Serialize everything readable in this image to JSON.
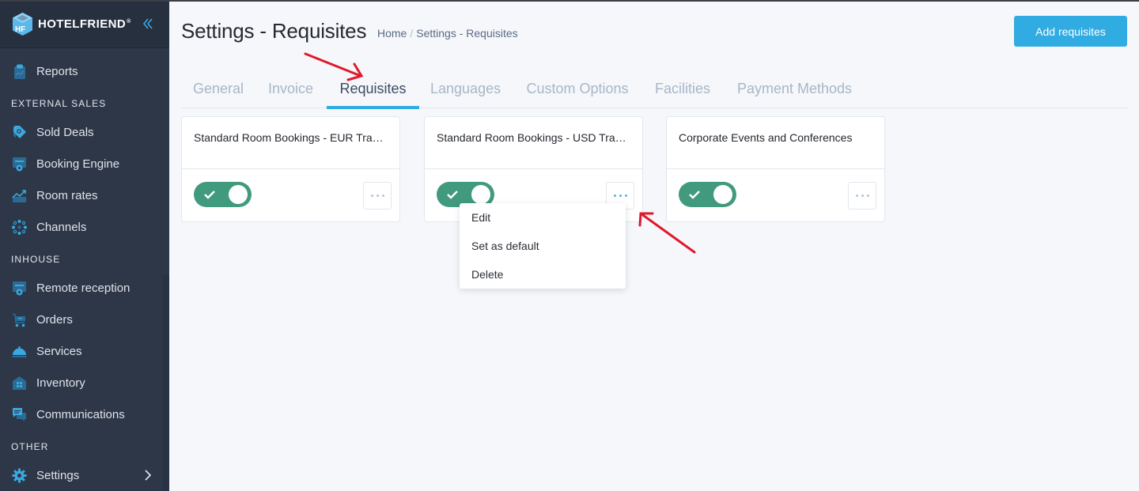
{
  "app": {
    "brand": "HOTELFRIEND",
    "brand_mark": "®",
    "logo_initials": "HF"
  },
  "sidebar": {
    "items_top": [
      {
        "label": "Reports",
        "icon": "clipboard-chart-icon"
      }
    ],
    "sections": [
      {
        "title": "EXTERNAL SALES",
        "items": [
          {
            "label": "Sold Deals",
            "icon": "tag-icon"
          },
          {
            "label": "Booking Engine",
            "icon": "browser-gear-icon"
          },
          {
            "label": "Room rates",
            "icon": "chart-rising-icon"
          },
          {
            "label": "Channels",
            "icon": "network-icon"
          }
        ]
      },
      {
        "title": "INHOUSE",
        "items": [
          {
            "label": "Remote reception",
            "icon": "browser-gear-icon"
          },
          {
            "label": "Orders",
            "icon": "cart-icon"
          },
          {
            "label": "Services",
            "icon": "cloche-icon"
          },
          {
            "label": "Inventory",
            "icon": "house-grid-icon"
          },
          {
            "label": "Communications",
            "icon": "chat-icon"
          }
        ]
      },
      {
        "title": "OTHER",
        "items": [
          {
            "label": "Settings",
            "icon": "gear-icon",
            "has_submenu": true
          }
        ]
      }
    ]
  },
  "header": {
    "title": "Settings - Requisites",
    "breadcrumb": [
      "Home",
      "Settings - Requisites"
    ],
    "breadcrumb_sep": "/",
    "add_button": "Add requisites"
  },
  "tabs": [
    {
      "label": "General",
      "active": false
    },
    {
      "label": "Invoice",
      "active": false
    },
    {
      "label": "Requisites",
      "active": true
    },
    {
      "label": "Languages",
      "active": false
    },
    {
      "label": "Custom Options",
      "active": false
    },
    {
      "label": "Facilities",
      "active": false
    },
    {
      "label": "Payment Methods",
      "active": false
    }
  ],
  "cards": [
    {
      "title": "Standard Room Bookings - EUR Transactions",
      "enabled": true
    },
    {
      "title": "Standard Room Bookings - USD Transactions",
      "enabled": true,
      "menu_open": true
    },
    {
      "title": "Corporate Events and Conferences",
      "enabled": true
    }
  ],
  "context_menu": {
    "items": [
      "Edit",
      "Set as default",
      "Delete"
    ]
  },
  "colors": {
    "accent": "#31ace2",
    "toggle_on": "#419a7e",
    "sidebar_bg": "#2e3748",
    "annotation_arrow": "#e0192d"
  }
}
